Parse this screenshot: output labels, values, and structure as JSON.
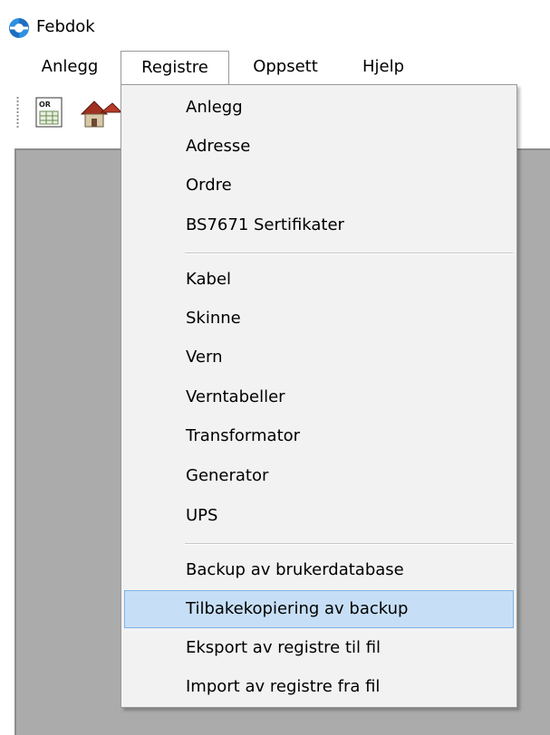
{
  "window": {
    "title": "Febdok"
  },
  "menubar": {
    "items": [
      "Anlegg",
      "Registre",
      "Oppsett",
      "Hjelp"
    ],
    "active": "Registre"
  },
  "toolbar": {
    "buttons": [
      "order-register-icon",
      "building-icon"
    ]
  },
  "dropdown": {
    "group1": [
      "Anlegg",
      "Adresse",
      "Ordre",
      "BS7671 Sertifikater"
    ],
    "group2": [
      "Kabel",
      "Skinne",
      "Vern",
      "Verntabeller",
      "Transformator",
      "Generator",
      "UPS"
    ],
    "group3": [
      "Backup av brukerdatabase",
      "Tilbakekopiering av backup",
      "Eksport av registre til fil",
      "Import av registre fra fil"
    ],
    "highlighted": "Tilbakekopiering av backup"
  },
  "colors": {
    "highlight_bg": "#c7dff6",
    "highlight_border": "#7fb2e5",
    "menu_bg": "#f2f2f2",
    "mdi_bg": "#ababab"
  }
}
